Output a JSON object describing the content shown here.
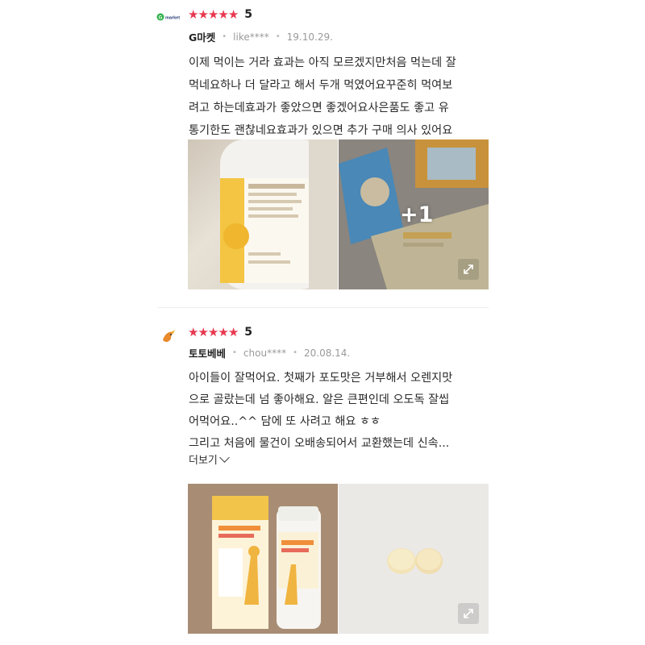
{
  "reviews": [
    {
      "rating": "5",
      "seller": "G마켓",
      "user": "like****",
      "date": "19.10.29.",
      "lines": [
        "이제 먹이는 거라 효과는 아직 모르겠지만처음 먹는데 잘",
        "먹네요하나 더 달라고 해서 두개 먹였어요꾸준히 먹여보",
        "려고 하는데효과가 좋았으면 좋겠어요사은품도 좋고 유",
        "통기한도 괜찮네요효과가 있으면 추가 구매 의사 있어요"
      ],
      "extra_photo_count": "+1",
      "logo_icon": "gmarket-logo-icon"
    },
    {
      "rating": "5",
      "seller": "토토베베",
      "user": "chou****",
      "date": "20.08.14.",
      "lines": [
        "아이들이 잘먹어요. 첫째가 포도맛은 거부해서 오렌지맛",
        "으로 골랐는데 넘 좋아해요. 알은 큰편인데 오도독 잘씹",
        "어먹어요..^^ 담에 또 사려고 해요 ㅎㅎ",
        "그리고 처음에 물건이 오배송되어서 교환했는데 신속..."
      ],
      "more_label": "더보기",
      "logo_icon": "bird-logo-icon"
    }
  ],
  "colors": {
    "star": "#e8384f",
    "divider": "#ececec"
  }
}
